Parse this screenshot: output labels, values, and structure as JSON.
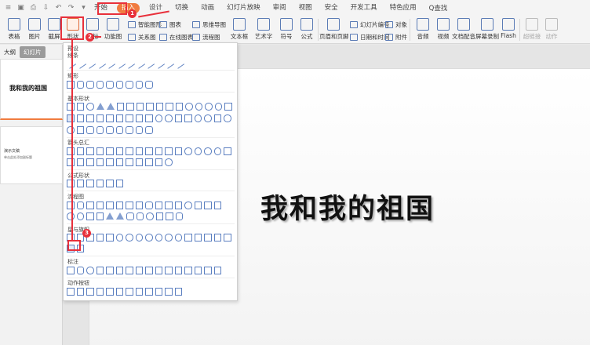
{
  "menu": {
    "tabs": [
      "开始",
      "插入",
      "设计",
      "切换",
      "动画",
      "幻灯片放映",
      "审阅",
      "视图",
      "安全",
      "开发工具",
      "特色应用"
    ],
    "active_index": 1,
    "search": "Q查找"
  },
  "toolbar": {
    "table": "表格",
    "image": "图片",
    "screenshot": "截屏",
    "shape": "形状",
    "icon": "图标",
    "function": "功能图",
    "smart_graphic": "智能图形",
    "chart": "图表",
    "relation": "关系图",
    "online_chart": "在线图表",
    "mind_map": "思维导图",
    "flow_chart": "流程图",
    "textbox": "文本框",
    "wordart": "艺术字",
    "symbol": "符号",
    "formula": "公式",
    "header_footer": "页眉和页脚",
    "slide_number": "幻灯片编号",
    "datetime": "日期和时间",
    "object": "对象",
    "attachment": "附件",
    "audio": "音频",
    "video": "视频",
    "doc_audio": "文档配音",
    "screen_record": "屏幕录制",
    "flash": "Flash",
    "hyperlink": "超链接",
    "action": "动作"
  },
  "leftpanel": {
    "outline": "大纲",
    "slides": "幻灯片",
    "thumb1_title": "我和我的祖国",
    "thumb2_title": "演示文稿",
    "thumb2_sub": "单击此处添加副标题"
  },
  "slide": {
    "title": "我和我的祖国"
  },
  "shapes_menu": {
    "recent": "预设",
    "categories": [
      "线条",
      "矩形",
      "基本形状",
      "箭头总汇",
      "公式形状",
      "流程图",
      "星与旗帜",
      "标注",
      "动作按钮"
    ]
  },
  "annotations": [
    "1",
    "2",
    "3"
  ],
  "colors": {
    "accent": "#f07b3f",
    "highlight": "#e8303b",
    "shape_stroke": "#5b7fc0"
  }
}
